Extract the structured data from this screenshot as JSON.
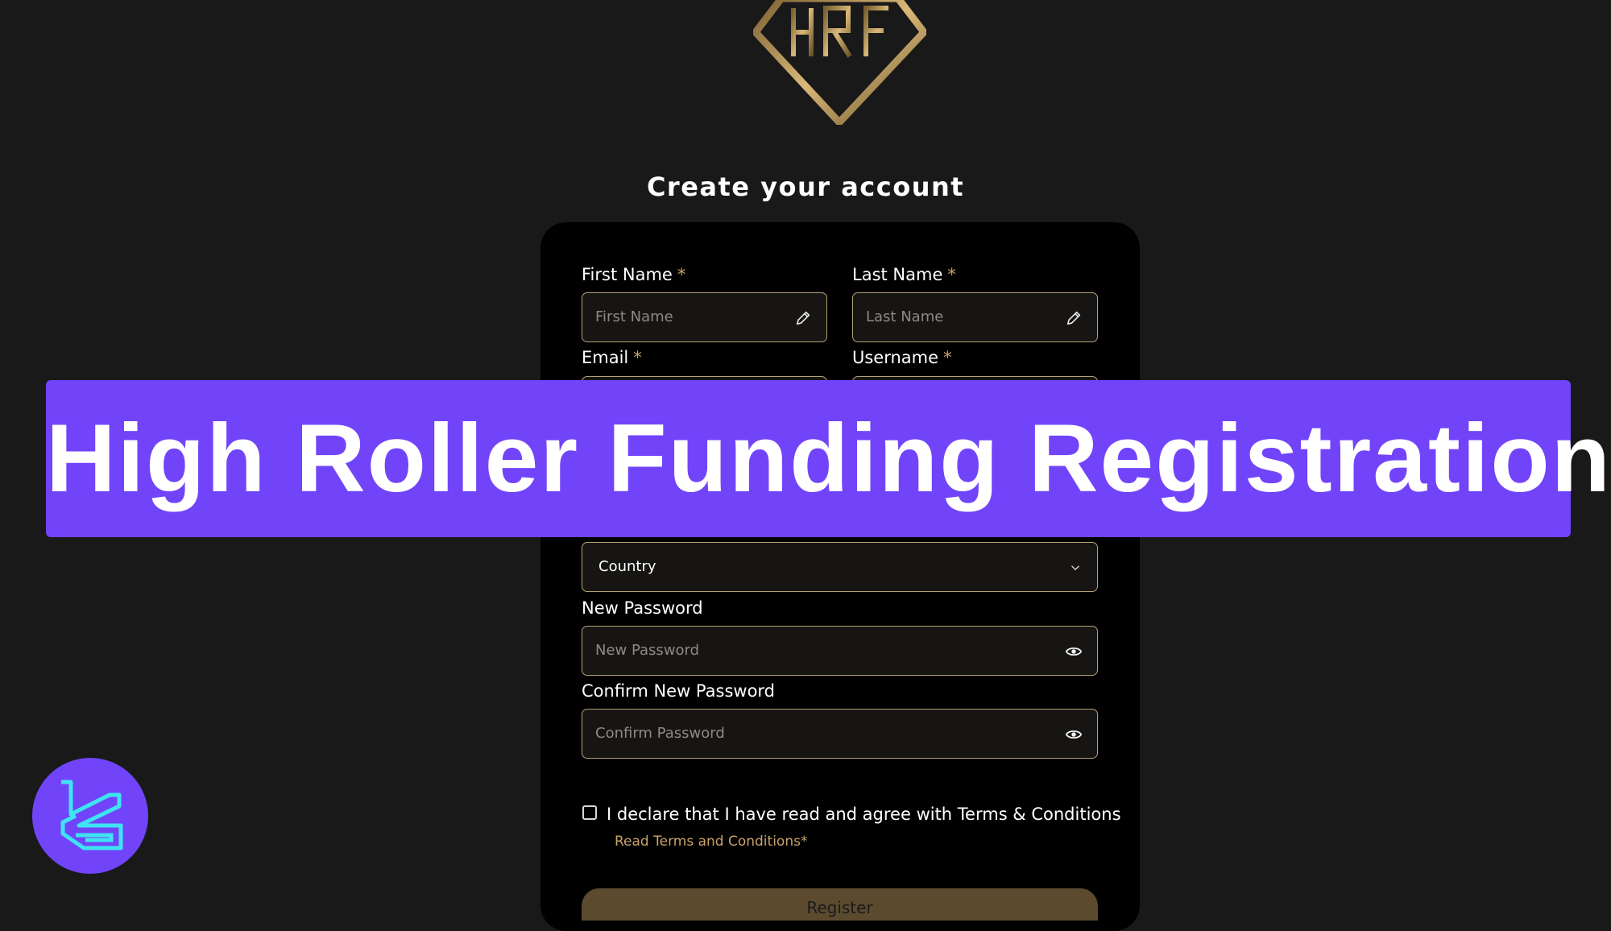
{
  "header": {
    "logo_text": "HRF",
    "page_title": "Create your account"
  },
  "form": {
    "required_mark": "*",
    "first_name": {
      "label": "First Name",
      "placeholder": "First Name"
    },
    "last_name": {
      "label": "Last Name",
      "placeholder": "Last Name"
    },
    "email": {
      "label": "Email"
    },
    "username": {
      "label": "Username"
    },
    "country": {
      "value": "Country"
    },
    "new_password": {
      "label": "New Password",
      "placeholder": "New Password"
    },
    "confirm_password": {
      "label": "Confirm New Password",
      "placeholder": "Confirm Password"
    },
    "declaration": "I declare that I have read and agree with Terms & Conditions",
    "terms_link": "Read Terms and Conditions*",
    "register_button": "Register"
  },
  "banner": {
    "text": "High Roller Funding Registration"
  },
  "colors": {
    "background": "#1a1919",
    "card": "#000000",
    "gold_accent": "#c8a26a",
    "input_border": "#b6a07a",
    "banner": "#7144fa",
    "badge_icon": "#3ee4f2"
  },
  "icons": {
    "first_name": "pencil-icon",
    "last_name": "pencil-icon",
    "country": "chevron-down-icon",
    "new_password": "eye-icon",
    "confirm_password": "eye-icon",
    "badge": "brand-logo-icon"
  }
}
